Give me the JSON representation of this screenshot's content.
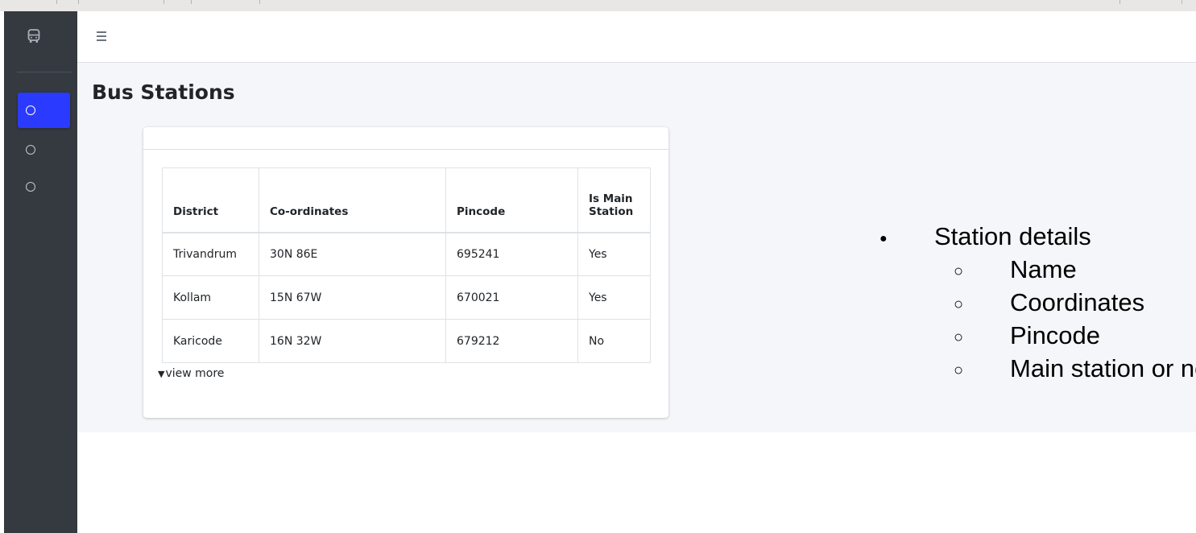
{
  "window": {},
  "sidebar": {
    "brand_icon": "bus-icon",
    "items": [
      {
        "icon": "circle-icon",
        "active": true
      },
      {
        "icon": "circle-icon",
        "active": false
      },
      {
        "icon": "circle-icon",
        "active": false
      }
    ],
    "active_color": "#2b3aff",
    "background_color": "#343a40"
  },
  "topbar": {
    "menu_icon": "hamburger-icon"
  },
  "main": {
    "page_title": "Bus Stations",
    "table": {
      "headers": [
        "District",
        "Co-ordinates",
        "Pincode",
        "Is Main Station"
      ],
      "rows": [
        [
          "Trivandrum",
          "30N 86E",
          "695241",
          "Yes"
        ],
        [
          "Kollam",
          "15N 67W",
          "670021",
          "Yes"
        ],
        [
          "Karicode",
          "16N 32W",
          "679212",
          "No"
        ]
      ]
    },
    "view_more_label": "view more",
    "view_more_icon": "caret-down-icon"
  },
  "notes": {
    "main": "Station details",
    "sub": [
      "Name",
      "Coordinates",
      "Pincode",
      "Main station or not"
    ]
  }
}
